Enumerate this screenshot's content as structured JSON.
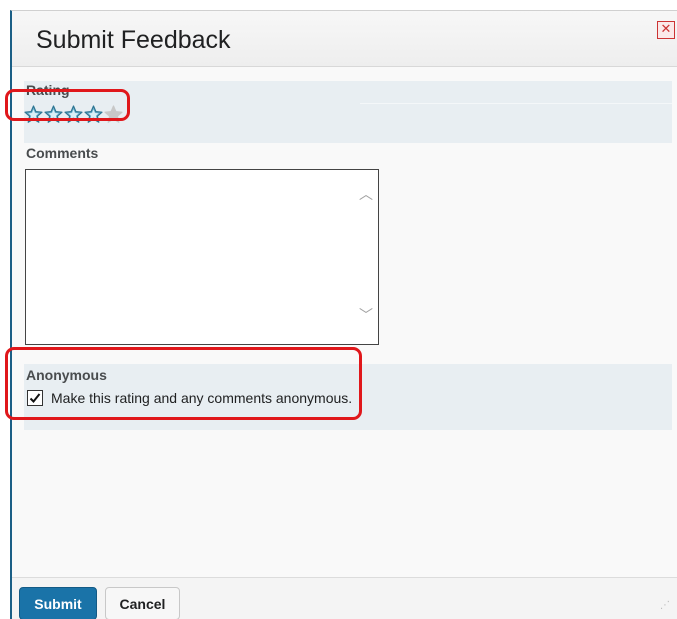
{
  "dialog": {
    "title": "Submit Feedback",
    "close_icon": "close-icon"
  },
  "rating": {
    "label": "Rating",
    "value": 4,
    "max": 5,
    "star_icon": "star-icon",
    "colors": {
      "filled": "#6fb3cf",
      "filled_stroke": "#2e7592",
      "empty": "#c8c8c8"
    }
  },
  "comments": {
    "label": "Comments",
    "value": "",
    "scroll_up_icon": "chevron-up-icon",
    "scroll_down_icon": "chevron-down-icon"
  },
  "anonymous": {
    "label": "Anonymous",
    "checkbox_label": "Make this rating and any comments anonymous.",
    "checked": true
  },
  "footer": {
    "submit_label": "Submit",
    "cancel_label": "Cancel"
  },
  "colors": {
    "accent": "#1a73a8",
    "highlight": "#e0171b",
    "section_bg": "#e8eef2"
  }
}
